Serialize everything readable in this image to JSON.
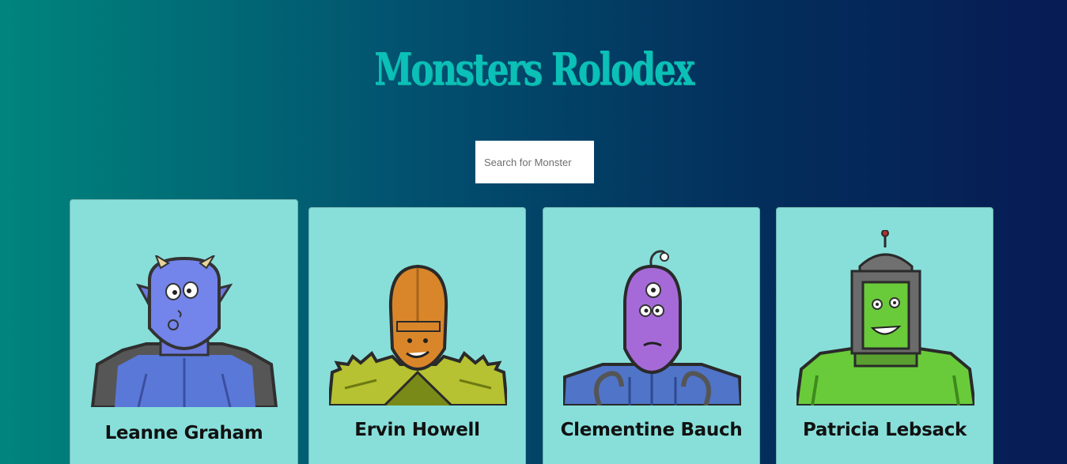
{
  "header": {
    "title": "Monsters Rolodex"
  },
  "search": {
    "placeholder": "Search for Monster",
    "value": ""
  },
  "monsters": [
    {
      "name": "Leanne Graham",
      "avatar_icon": "blue-horned-monster-icon",
      "color": "#6f7fe0"
    },
    {
      "name": "Ervin Howell",
      "avatar_icon": "orange-spiky-monster-icon",
      "color": "#d9862a"
    },
    {
      "name": "Clementine Bauch",
      "avatar_icon": "purple-cyclops-monster-icon",
      "color": "#a56ad8"
    },
    {
      "name": "Patricia Lebsack",
      "avatar_icon": "green-robot-monster-icon",
      "color": "#6acb3a"
    }
  ],
  "colors": {
    "title": "#0bc0b7",
    "card_background": "#88dfda"
  }
}
